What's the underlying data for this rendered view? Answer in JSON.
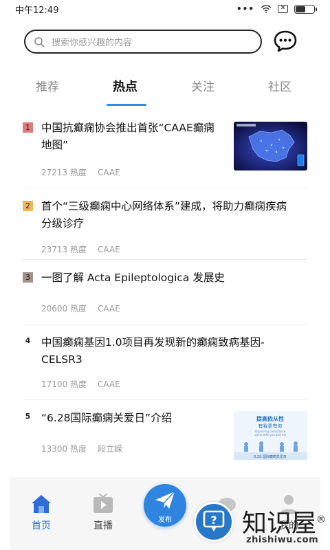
{
  "status_bar": {
    "time": "中午12:49",
    "dots": "•••"
  },
  "search": {
    "placeholder": "搜索你感兴趣的内容"
  },
  "tabs": [
    {
      "label": "推荐",
      "active": false
    },
    {
      "label": "热点",
      "active": true
    },
    {
      "label": "关注",
      "active": false
    },
    {
      "label": "社区",
      "active": false
    }
  ],
  "feed": [
    {
      "rank": "1",
      "title_line1": "中国抗癫痫协会推出首张“CAAE癫痫",
      "title_line2": "地图”",
      "heat": "27213 热度",
      "source": "CAAE",
      "has_thumb": true,
      "thumb_name": "china-map-thumbnail"
    },
    {
      "rank": "2",
      "title_line1": "首个“三级癫痫中心网络体系”建成，将助力癫痫疾病",
      "title_line2": "分级诊疗",
      "heat": "23713 热度",
      "source": "CAAE",
      "has_thumb": false
    },
    {
      "rank": "3",
      "title_line1": "一图了解 Acta Epileptologica 发展史",
      "title_line2": "",
      "heat": "20600 热度",
      "source": "CAAE",
      "has_thumb": false
    },
    {
      "rank": "4",
      "title_line1": "中国癫痫基因1.0项目再发现新的癫痫致病基因-",
      "title_line2": "CELSR3",
      "heat": "17100 热度",
      "source": "CAAE",
      "has_thumb": false
    },
    {
      "rank": "5",
      "title_line1": "“6.28国际癫痫关爱日”介绍",
      "title_line2": "",
      "heat": "13300 热度",
      "source": "段立嵘",
      "has_thumb": true,
      "thumb_name": "epilepsy-day-poster-thumbnail",
      "thumb_text": {
        "headline_1": "提高依从性",
        "headline_2": "有我更有你",
        "subline": "Improving compliance",
        "sub2": "starts with you and me",
        "footer": "6.28 国际癫痫关爱日"
      }
    }
  ],
  "bottom_nav": {
    "home": "首页",
    "live": "直播",
    "publish": "发布",
    "mine": "我的"
  },
  "watermark": {
    "text": "知识屋",
    "url": "zhishiwu.com",
    "registered": "®",
    "badge_glyph": "?"
  },
  "colors": {
    "accent": "#2f84e0",
    "rank1": "#e07a7a",
    "rank2": "#f2b65b",
    "rank3": "#a39088"
  }
}
